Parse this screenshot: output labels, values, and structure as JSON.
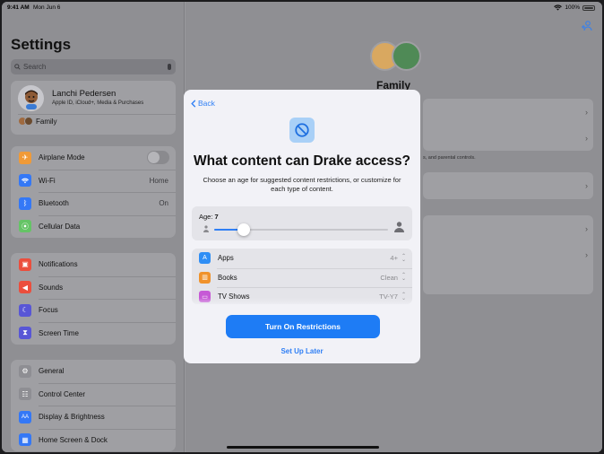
{
  "status": {
    "time": "9:41 AM",
    "date": "Mon Jun 6",
    "battery": "100%"
  },
  "sidebar": {
    "title": "Settings",
    "search_placeholder": "Search",
    "profile": {
      "name": "Lanchi Pedersen",
      "subtitle": "Apple ID, iCloud+, Media & Purchases",
      "family_label": "Family"
    },
    "group1": [
      {
        "label": "Airplane Mode",
        "icon": "airplane-icon",
        "color": "#f09a37"
      },
      {
        "label": "Wi-Fi",
        "value": "Home",
        "icon": "wifi-icon",
        "color": "#3478f6"
      },
      {
        "label": "Bluetooth",
        "value": "On",
        "icon": "bluetooth-icon",
        "color": "#3478f6"
      },
      {
        "label": "Cellular Data",
        "icon": "antenna-icon",
        "color": "#65c466"
      }
    ],
    "group2": [
      {
        "label": "Notifications",
        "icon": "bell-icon",
        "color": "#eb4e3d"
      },
      {
        "label": "Sounds",
        "icon": "speaker-icon",
        "color": "#eb4e3d"
      },
      {
        "label": "Focus",
        "icon": "moon-icon",
        "color": "#5856d6"
      },
      {
        "label": "Screen Time",
        "icon": "hourglass-icon",
        "color": "#5856d6"
      }
    ],
    "group3": [
      {
        "label": "General",
        "icon": "gear-icon",
        "color": "#8e8e93"
      },
      {
        "label": "Control Center",
        "icon": "sliders-icon",
        "color": "#8e8e93"
      },
      {
        "label": "Display & Brightness",
        "icon": "text-size-icon",
        "color": "#3478f6"
      },
      {
        "label": "Home Screen & Dock",
        "icon": "grid-icon",
        "color": "#3478f6"
      }
    ]
  },
  "main": {
    "family_title": "Family",
    "note": "s, and parental controls."
  },
  "modal": {
    "back_label": "Back",
    "title": "What content can Drake access?",
    "description": "Choose an age for suggested content restrictions, or customize for each type of content.",
    "age_label": "Age: ",
    "age_value": "7",
    "slider_fraction": 0.17,
    "content_rows": [
      {
        "label": "Apps",
        "value": "4+",
        "icon": "app-store-icon",
        "color": "#2f8ef5"
      },
      {
        "label": "Books",
        "value": "Clean",
        "icon": "book-icon",
        "color": "#f0922b"
      },
      {
        "label": "TV Shows",
        "value": "TV-Y7",
        "icon": "tv-icon",
        "color": "#c659d6"
      }
    ],
    "primary_button": "Turn On Restrictions",
    "secondary_button": "Set Up Later"
  },
  "accent": "#2f7ff5"
}
